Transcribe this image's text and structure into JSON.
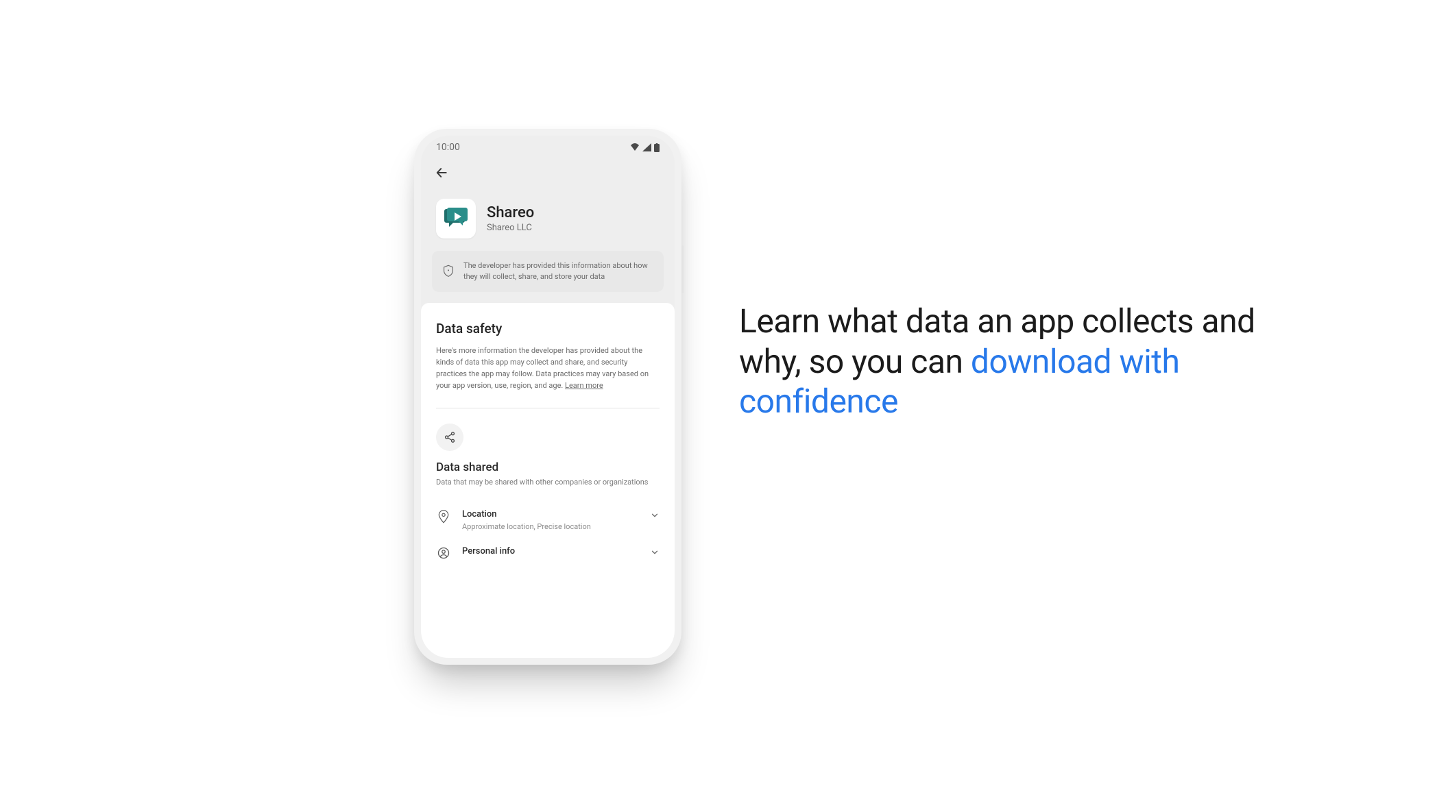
{
  "status": {
    "time": "10:00"
  },
  "app": {
    "name": "Shareo",
    "developer": "Shareo LLC",
    "notice": "The developer has provided this information about how they will collect, share, and store your data"
  },
  "data_safety": {
    "title": "Data safety",
    "body": "Here's more information the developer has provided about the kinds of data this app may collect and share, and security practices the app may follow. Data practices may vary based on your app version, use, region, and age. ",
    "learn_more": "Learn more"
  },
  "data_shared": {
    "title": "Data shared",
    "subtitle": "Data that may be shared with other companies or organizations",
    "rows": [
      {
        "title": "Location",
        "sub": "Approximate location, Precise location"
      },
      {
        "title": "Personal info",
        "sub": ""
      }
    ]
  },
  "headline": {
    "line1": "Learn what data an app collects and why, so you can ",
    "accent": "download with confidence"
  }
}
